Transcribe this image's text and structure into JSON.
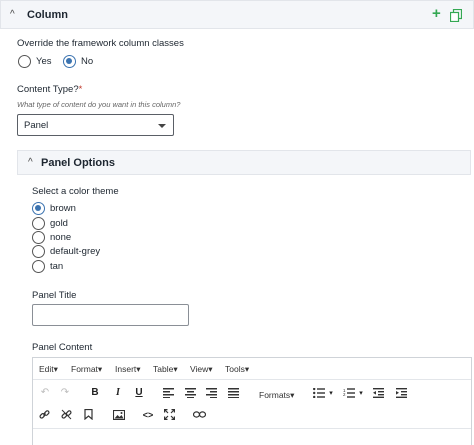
{
  "column": {
    "title": "Column",
    "caret": "^",
    "add": "+"
  },
  "override": {
    "label": "Override the framework column classes",
    "options": [
      "Yes",
      "No"
    ],
    "selected": "No"
  },
  "content_type": {
    "label": "Content Type?",
    "required_mark": "*",
    "help": "What type of content do you want in this column?",
    "value": "Panel"
  },
  "panel_options": {
    "title": "Panel Options",
    "caret": "^",
    "theme_label": "Select a color theme",
    "themes": [
      "brown",
      "gold",
      "none",
      "default-grey",
      "tan"
    ],
    "selected_theme": "brown",
    "title_label": "Panel Title",
    "title_value": "",
    "content_label": "Panel Content"
  },
  "editor": {
    "menu": [
      "Edit",
      "Format",
      "Insert",
      "Table",
      "View",
      "Tools"
    ],
    "formats_label": "Formats"
  },
  "colors": {
    "accent": "#3b73b0",
    "add_green": "#34a853",
    "header_bg": "#f4f6f9"
  }
}
